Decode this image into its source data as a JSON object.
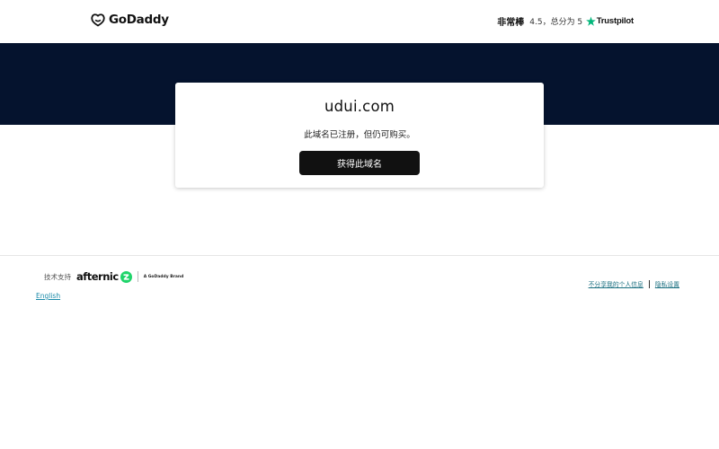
{
  "header": {
    "logo_text": "GoDaddy",
    "rating_word": "非常棒",
    "rating_score": "4.5，总分为 5",
    "trustpilot_label": "Trustpilot"
  },
  "card": {
    "domain": "udui.com",
    "status": "此域名已注册，但仍可购买。",
    "buy_label": "获得此域名"
  },
  "footer": {
    "powered_label": "技术支持",
    "afternic_text": "afternic",
    "godaddy_brand": "A GoDaddy Brand",
    "language": "English",
    "links": [
      "不分享我的个人信息",
      "隐私设置"
    ]
  },
  "colors": {
    "band": "#05132e",
    "button": "#111111",
    "trustpilot_star": "#00b67a",
    "afternic_green": "#1fd46a",
    "link": "#1a8aa8"
  }
}
